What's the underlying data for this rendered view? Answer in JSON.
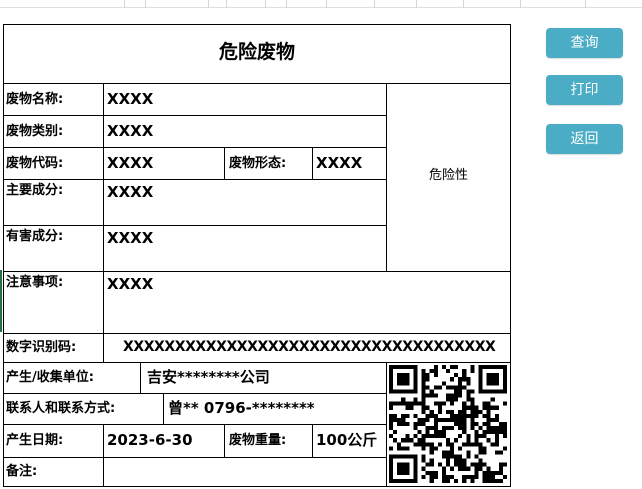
{
  "form": {
    "title": "危险废物",
    "hazard_label": "危险性",
    "fields": {
      "waste_name": {
        "label": "废物名称:",
        "value": "XXXX"
      },
      "waste_type": {
        "label": "废物类别:",
        "value": "XXXX"
      },
      "waste_code": {
        "label": "废物代码:",
        "value": "XXXX"
      },
      "waste_form": {
        "label": "废物形态:",
        "value": "XXXX"
      },
      "main_comp": {
        "label": "主要成分:",
        "value": "XXXX"
      },
      "harmful_comp": {
        "label": "有害成分:",
        "value": "XXXX"
      },
      "notes": {
        "label": "注意事项:",
        "value": "XXXX"
      },
      "digital_id": {
        "label": "数字识别码:",
        "value": "XXXXXXXXXXXXXXXXXXXXXXXXXXXXXXXXXXXX"
      },
      "producer": {
        "label": "产生/收集单位:",
        "value": "吉安********公司"
      },
      "contact": {
        "label": "联系人和联系方式:",
        "value": "曾** 0796-********"
      },
      "date": {
        "label": "产生日期:",
        "value": "2023-6-30"
      },
      "weight": {
        "label": "废物重量:",
        "value": "100公斤"
      },
      "remark": {
        "label": "备注:",
        "value": ""
      }
    }
  },
  "buttons": {
    "query": "查询",
    "print": "打印",
    "back": "返回"
  },
  "colors": {
    "button_bg": "#4bacc6",
    "button_text": "#ffffff",
    "border": "#000000"
  },
  "icons": [
    "qr-code-icon"
  ]
}
